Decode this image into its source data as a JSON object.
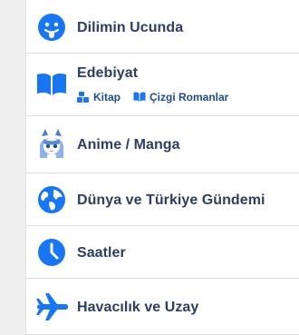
{
  "menu": {
    "items": [
      {
        "label": "Dilimin Ucunda",
        "icon": "tongue-face-icon"
      },
      {
        "label": "Edebiyat",
        "icon": "open-book-icon",
        "submenu": [
          {
            "label": "Kitap",
            "icon": "book-stack-icon"
          },
          {
            "label": "Çizgi Romanlar",
            "icon": "open-book-small-icon"
          }
        ]
      },
      {
        "label": "Anime / Manga",
        "icon": "anime-character-icon"
      },
      {
        "label": "Dünya ve Türkiye Gündemi",
        "icon": "globe-icon"
      },
      {
        "label": "Saatler",
        "icon": "clock-icon"
      },
      {
        "label": "Havacılık ve Uzay",
        "icon": "airplane-icon"
      }
    ]
  },
  "colors": {
    "accent": "#1976f2",
    "text": "#2a3f63",
    "subtext": "#1d4c8f",
    "gutter": "#efefef",
    "divider": "#dedede"
  }
}
